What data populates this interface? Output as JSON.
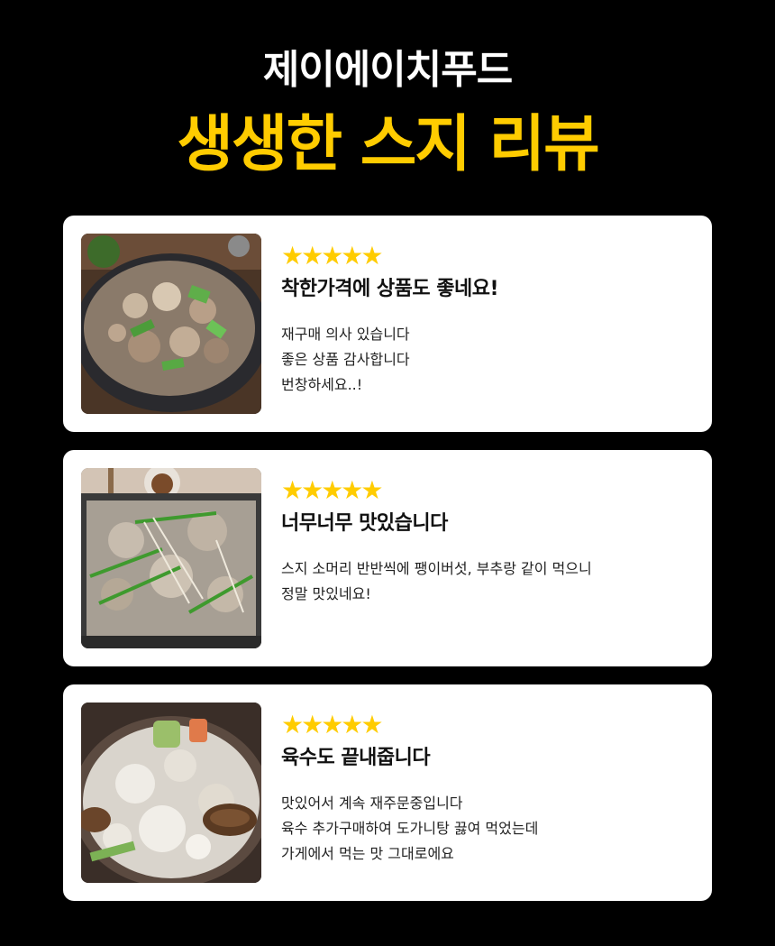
{
  "header": {
    "brand": "제이에이치푸드",
    "headline": "생생한 스지 리뷰"
  },
  "colors": {
    "background": "#000000",
    "accent": "#ffcc00",
    "card": "#ffffff"
  },
  "reviews": [
    {
      "stars": "★★★★★",
      "rating": 5,
      "title": "착한가격에 상품도 좋네요!",
      "body": "재구매 의사 있습니다\n좋은 상품 감사합니다\n번창하세요..!"
    },
    {
      "stars": "★★★★★",
      "rating": 5,
      "title": "너무너무 맛있습니다",
      "body": "스지 소머리 반반씩에 팽이버섯, 부추랑 같이 먹으니\n정말 맛있네요!"
    },
    {
      "stars": "★★★★★",
      "rating": 5,
      "title": "육수도 끝내줍니다",
      "body": "맛있어서 계속 재주문중입니다\n육수 추가구매하여 도가니탕 끓여 먹었는데\n가게에서 먹는 맛 그대로에요"
    }
  ]
}
